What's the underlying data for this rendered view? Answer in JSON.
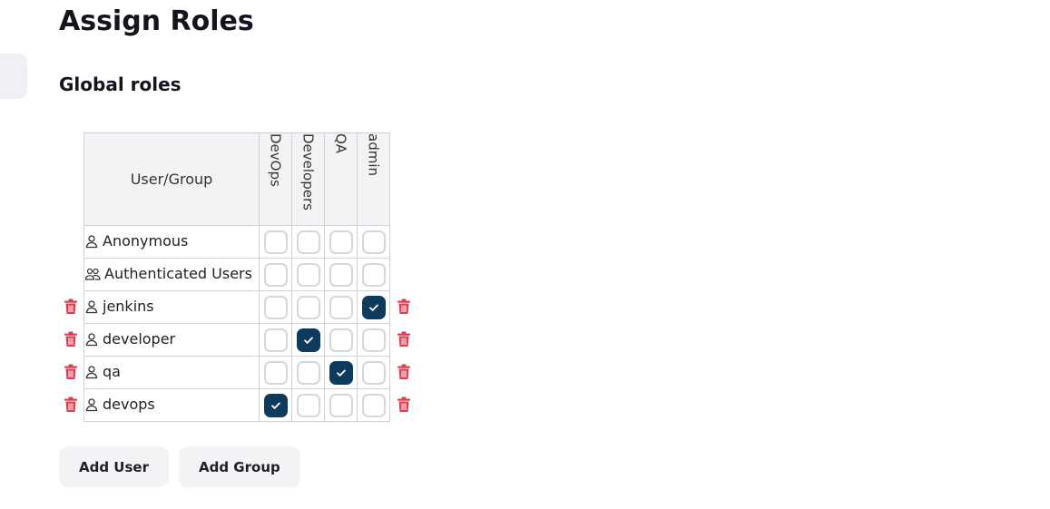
{
  "page": {
    "title": "Assign Roles",
    "section_title": "Global roles"
  },
  "table": {
    "user_group_header": "User/Group",
    "roles": [
      "DevOps",
      "Developers",
      "QA",
      "admin"
    ],
    "rows": [
      {
        "name": "Anonymous",
        "icon": "user-icon",
        "deletable": false,
        "checks": [
          false,
          false,
          false,
          false
        ]
      },
      {
        "name": "Authenticated Users",
        "icon": "group-icon",
        "deletable": false,
        "checks": [
          false,
          false,
          false,
          false
        ]
      },
      {
        "name": "jenkins",
        "icon": "user-icon",
        "deletable": true,
        "checks": [
          false,
          false,
          false,
          true
        ]
      },
      {
        "name": "developer",
        "icon": "user-icon",
        "deletable": true,
        "checks": [
          false,
          true,
          false,
          false
        ]
      },
      {
        "name": "qa",
        "icon": "user-icon",
        "deletable": true,
        "checks": [
          false,
          false,
          true,
          false
        ]
      },
      {
        "name": "devops",
        "icon": "user-icon",
        "deletable": true,
        "checks": [
          true,
          false,
          false,
          false
        ]
      }
    ]
  },
  "buttons": {
    "add_user": "Add User",
    "add_group": "Add Group"
  },
  "colors": {
    "checked": "#0e3a5b",
    "delete": "#e03c4f"
  }
}
